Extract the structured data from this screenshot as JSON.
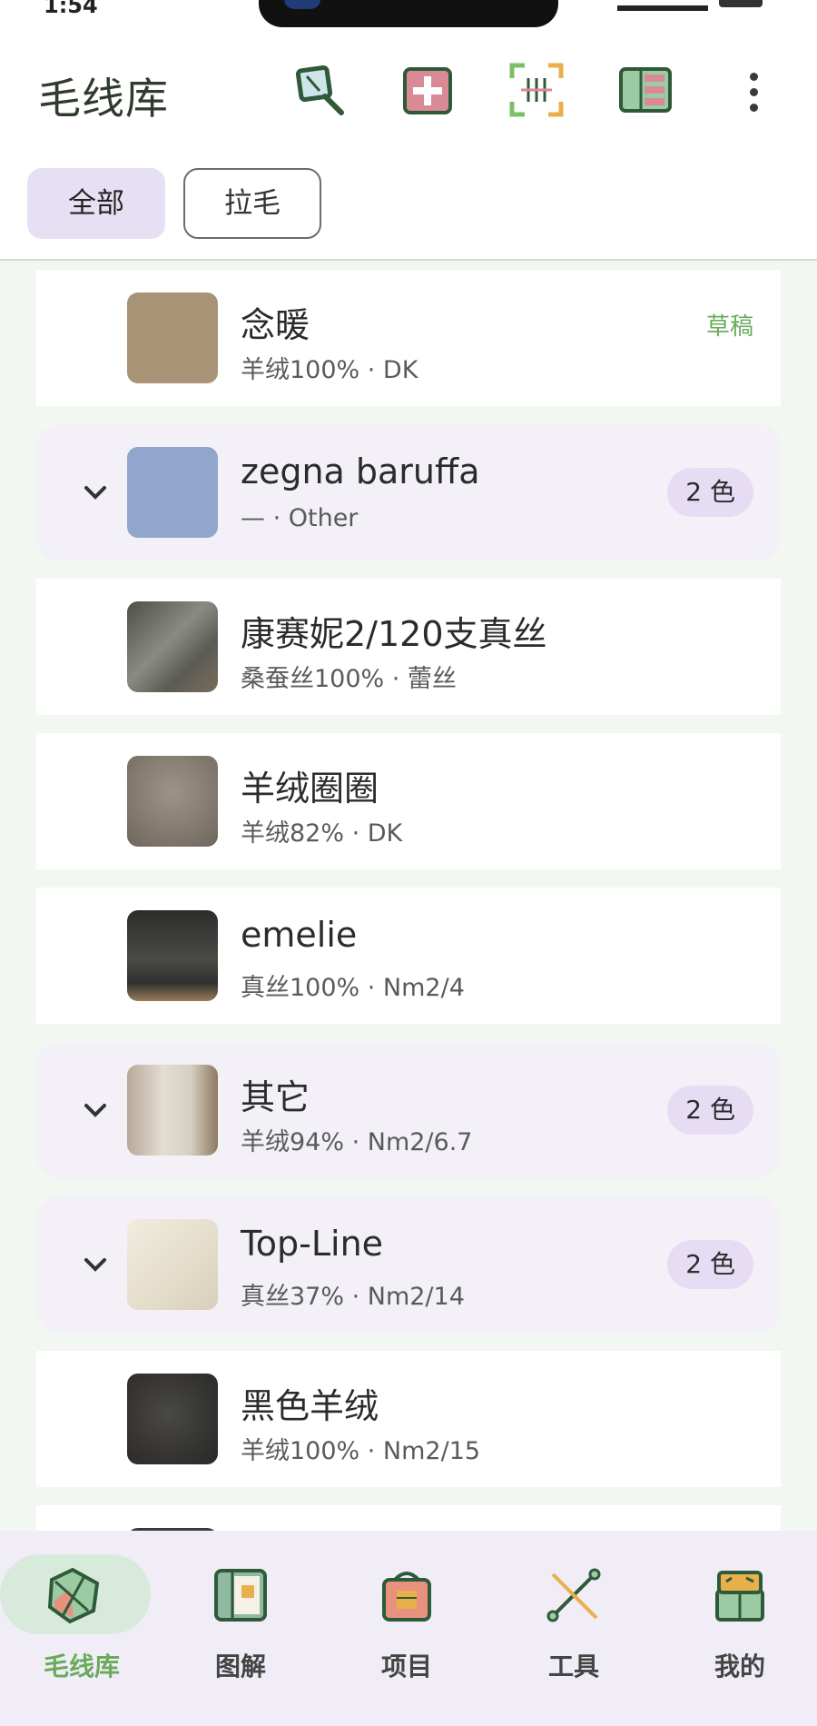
{
  "status_bar": {
    "time": "1:54"
  },
  "header": {
    "title": "毛线库"
  },
  "filters": {
    "all": "全部",
    "lamao": "拉毛"
  },
  "list": [
    {
      "name": "念暖",
      "sub": "羊绒100% · DK",
      "status": "草稿",
      "color": "#a89377"
    },
    {
      "name": "zegna baruffa",
      "sub": "— · Other",
      "badge": "2 色",
      "color": "#91a6cc"
    },
    {
      "name": "康赛妮2/120支真丝",
      "sub": "桑蚕丝100% · 蕾丝",
      "color": "#6d6e65"
    },
    {
      "name": "羊绒圈圈",
      "sub": "羊绒82% · DK",
      "color": "#8f857a"
    },
    {
      "name": "emelie",
      "sub": "真丝100% · Nm2/4",
      "color": "#3b3c39"
    },
    {
      "name": "其它",
      "sub": "羊绒94% · Nm2/6.7",
      "badge": "2 色",
      "color": "#d9d2c6"
    },
    {
      "name": "Top-Line",
      "sub": "真丝37% · Nm2/14",
      "badge": "2 色",
      "color": "#e8e1d0"
    },
    {
      "name": "黑色羊绒",
      "sub": "羊绒100% · Nm2/15",
      "color": "#3a3a38"
    }
  ],
  "nav": [
    {
      "label": "毛线库",
      "icon": "yarn-library-icon",
      "active": true
    },
    {
      "label": "图解",
      "icon": "chart-book-icon"
    },
    {
      "label": "项目",
      "icon": "project-bag-icon"
    },
    {
      "label": "工具",
      "icon": "knitting-needles-icon"
    },
    {
      "label": "我的",
      "icon": "profile-box-icon"
    }
  ],
  "colors": {
    "accent_green": "#6aaa5c",
    "chip_purple": "#e7e0f4",
    "group_bg": "#f3f0f8"
  }
}
